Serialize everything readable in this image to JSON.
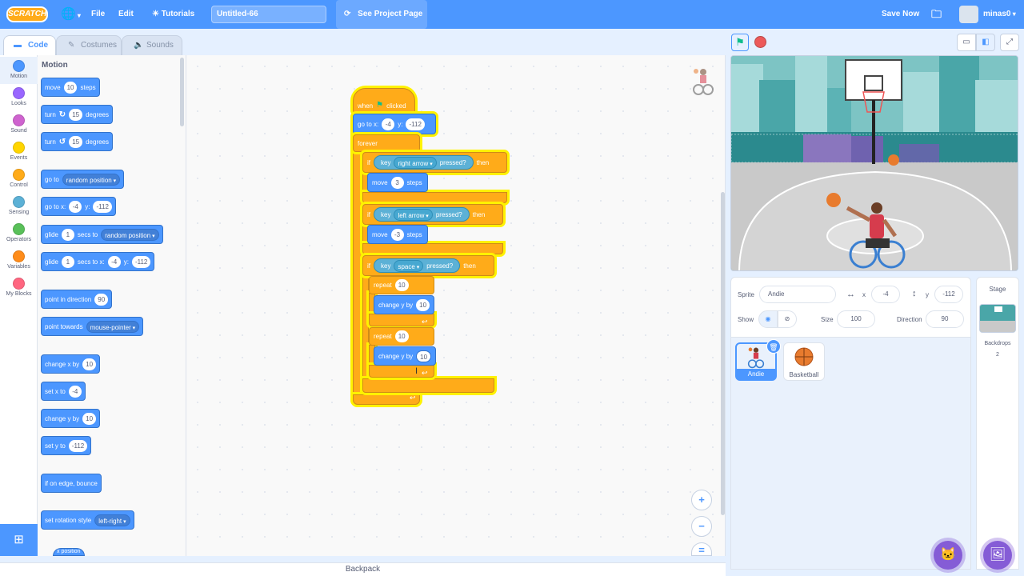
{
  "menubar": {
    "logo": "SCRATCH",
    "language_icon": "globe-icon",
    "file": "File",
    "edit": "Edit",
    "tutorials": "Tutorials",
    "project_title": "Untitled-66",
    "see_project_page": "See Project Page",
    "save_now": "Save Now",
    "username": "minas0"
  },
  "editor_tabs": {
    "code": "Code",
    "costumes": "Costumes",
    "sounds": "Sounds"
  },
  "categories": [
    {
      "label": "Motion",
      "color": "#4c97ff"
    },
    {
      "label": "Looks",
      "color": "#9966ff"
    },
    {
      "label": "Sound",
      "color": "#cf63cf"
    },
    {
      "label": "Events",
      "color": "#ffd500"
    },
    {
      "label": "Control",
      "color": "#ffab19"
    },
    {
      "label": "Sensing",
      "color": "#5cb1d6"
    },
    {
      "label": "Operators",
      "color": "#59c059"
    },
    {
      "label": "Variables",
      "color": "#ff8c1a"
    },
    {
      "label": "My Blocks",
      "color": "#ff6680"
    }
  ],
  "palette": {
    "title": "Motion",
    "move": {
      "a": "move",
      "v": "10",
      "b": "steps"
    },
    "turn_right": {
      "a": "turn",
      "v": "15",
      "b": "degrees"
    },
    "turn_left": {
      "a": "turn",
      "v": "15",
      "b": "degrees"
    },
    "goto": {
      "a": "go to",
      "v": "random position"
    },
    "goto_xy": {
      "a": "go to x:",
      "x": "-4",
      "b": "y:",
      "y": "-112"
    },
    "glide": {
      "a": "glide",
      "v": "1",
      "b": "secs to",
      "target": "random position"
    },
    "glide_xy": {
      "a": "glide",
      "v": "1",
      "b": "secs to x:",
      "x": "-4",
      "c": "y:",
      "y": "-112"
    },
    "point_dir": {
      "a": "point in direction",
      "v": "90"
    },
    "point_towards": {
      "a": "point towards",
      "v": "mouse-pointer"
    },
    "change_x": {
      "a": "change x by",
      "v": "10"
    },
    "set_x": {
      "a": "set x to",
      "v": "-4"
    },
    "change_y": {
      "a": "change y by",
      "v": "10"
    },
    "set_y": {
      "a": "set y to",
      "v": "-112"
    },
    "bounce": {
      "a": "if on edge, bounce"
    },
    "rotation": {
      "a": "set rotation style",
      "v": "left-right"
    },
    "x_position": {
      "a": "x position"
    }
  },
  "script": {
    "hat": {
      "a": "when",
      "b": "clicked"
    },
    "goto": {
      "a": "go to x:",
      "x": "-4",
      "b": "y:",
      "y": "-112"
    },
    "forever": "forever",
    "if1": {
      "if": "if",
      "key": "key",
      "v": "right arrow",
      "pressed": "pressed?",
      "then": "then"
    },
    "move1": {
      "a": "move",
      "v": "3",
      "b": "steps"
    },
    "if2": {
      "if": "if",
      "key": "key",
      "v": "left arrow",
      "pressed": "pressed?",
      "then": "then"
    },
    "move2": {
      "a": "move",
      "v": "-3",
      "b": "steps"
    },
    "if3": {
      "if": "if",
      "key": "key",
      "v": "space",
      "pressed": "pressed?",
      "then": "then"
    },
    "repeat1": {
      "a": "repeat",
      "v": "10"
    },
    "changey1": {
      "a": "change y by",
      "v": "10"
    },
    "repeat2": {
      "a": "repeat",
      "v": "10"
    },
    "changey2": {
      "a": "change y by",
      "v": "10"
    }
  },
  "backpack": "Backpack",
  "sprite_info": {
    "sprite_label": "Sprite",
    "sprite_name": "Andie",
    "x_label": "x",
    "x": "-4",
    "y_label": "y",
    "y": "-112",
    "show_label": "Show",
    "size_label": "Size",
    "size": "100",
    "direction_label": "Direction",
    "direction": "90"
  },
  "sprites": [
    {
      "name": "Andie",
      "selected": true
    },
    {
      "name": "Basketball",
      "selected": false
    }
  ],
  "stage_panel": {
    "title": "Stage",
    "backdrops_label": "Backdrops",
    "backdrops_count": "2"
  }
}
